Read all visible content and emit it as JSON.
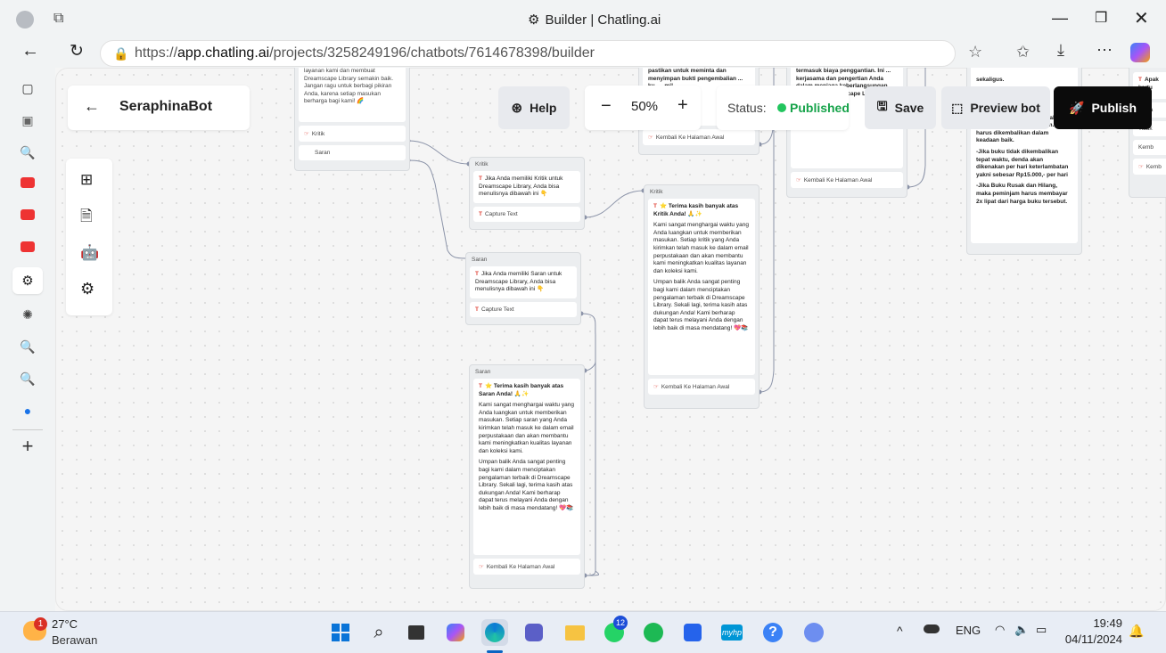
{
  "window": {
    "title": "Builder | Chatling.ai",
    "url_prefix": "https://",
    "url_host": "app.chatling.ai",
    "url_path": "/projects/3258249196/chatbots/7614678398/builder"
  },
  "header": {
    "bot_name": "SeraphinaBot",
    "help_label": "Help",
    "zoom": "50%",
    "status_label": "Status:",
    "status_value": "Published",
    "save_label": "Save",
    "preview_label": "Preview bot",
    "publish_label": "Publish"
  },
  "nodes": {
    "top_left": {
      "text1": "layanan kami dan membuat Dreamscape Library semakin baik. Jangan ragu untuk berbagi pikiran Anda, karena setiap masukan berharga bagi kami! 🌈",
      "opt1": "Kritik",
      "opt2": "Saran"
    },
    "kritik1": {
      "header": "Kritik",
      "text": "Jika Anda memiliki Kritik untuk Dreamscape Library, Anda bisa menulisnya dibawah ini 👇",
      "capture": "Capture Text"
    },
    "saran1": {
      "header": "Saran",
      "text": "Jika Anda memiliki Saran untuk Dreamscape Library, Anda bisa menulisnya dibawah ini 👇",
      "capture": "Capture Text"
    },
    "saran2": {
      "header": "Saran",
      "title": "⭐ Terima kasih banyak atas Saran Anda! 🙏✨",
      "p1": "Kami sangat menghargai waktu yang Anda luangkan untuk memberikan masukan. Setiap saran yang Anda kirimkan telah masuk ke dalam email perpustakaan dan akan membantu kami meningkatkan kualitas layanan dan koleksi kami.",
      "p2": "Umpan balik Anda sangat penting bagi kami dalam menciptakan pengalaman terbaik di Dreamscape Library. Sekali lagi, terima kasih atas dukungan Anda! Kami berharap dapat terus melayani Anda dengan lebih baik di masa mendatang! 💖📚",
      "back": "Kembali Ke Halaman Awal"
    },
    "kritik2": {
      "header": "Kritik",
      "title": "⭐ Terima kasih banyak atas Kritik Anda! 🙏✨",
      "p1": "Kami sangat menghargai waktu yang Anda luangkan untuk memberikan masukan. Setiap kritik yang Anda kirimkan telah masuk ke dalam email perpustakaan dan akan membantu kami meningkatkan kualitas layanan dan koleksi kami.",
      "p2": "Umpan balik Anda sangat penting bagi kami dalam menciptakan pengalaman terbaik di Dreamscape Library. Sekali lagi, terima kasih atas dukungan Anda! Kami berharap dapat terus melayani Anda dengan lebih baik di masa mendatang! 💖📚",
      "back": "Kembali Ke Halaman Awal"
    },
    "top_mid": {
      "text": "pastikan untuk meminta dan menyimpan bukti pengembalian ... ku. ... mi!",
      "back": "Kembali Ke Halaman Awal"
    },
    "top_mid2": {
      "text": "termasuk biaya penggantian. Ini ... kerjasama dan pengertian Anda dalam menjaga keberlangsungan layanan di Dreamscape Library. Terima kasih! 💖✨",
      "back": "Kembali Ke Halaman Awal"
    },
    "right": {
      "l0": "sekaligus.",
      "l1": "-Anggota bertanggung jawab atas kondisi buku yang dipinjam. Buku harus dikembalikan dalam keadaan baik.",
      "l2": "-Jika buku tidak dikembalikan tepat waktu, denda akan dikenakan per hari keterlambatan yakni sebesar Rp15.000,- per hari",
      "l3": "-Jika Buku Rusak dan Hilang, maka peminjam harus membayar 2x lipat dari harga buku tersebut."
    },
    "far_right": {
      "t1": "Apak kartu",
      "t2": "ra, sa",
      "t3": "Tidak",
      "t4": "Kemb",
      "t5": "Kemb"
    }
  },
  "taskbar": {
    "temp": "27°C",
    "weather": "Berawan",
    "weather_badge": "1",
    "lang": "ENG",
    "time": "19:49",
    "date": "04/11/2024",
    "whatsapp_badge": "12"
  }
}
